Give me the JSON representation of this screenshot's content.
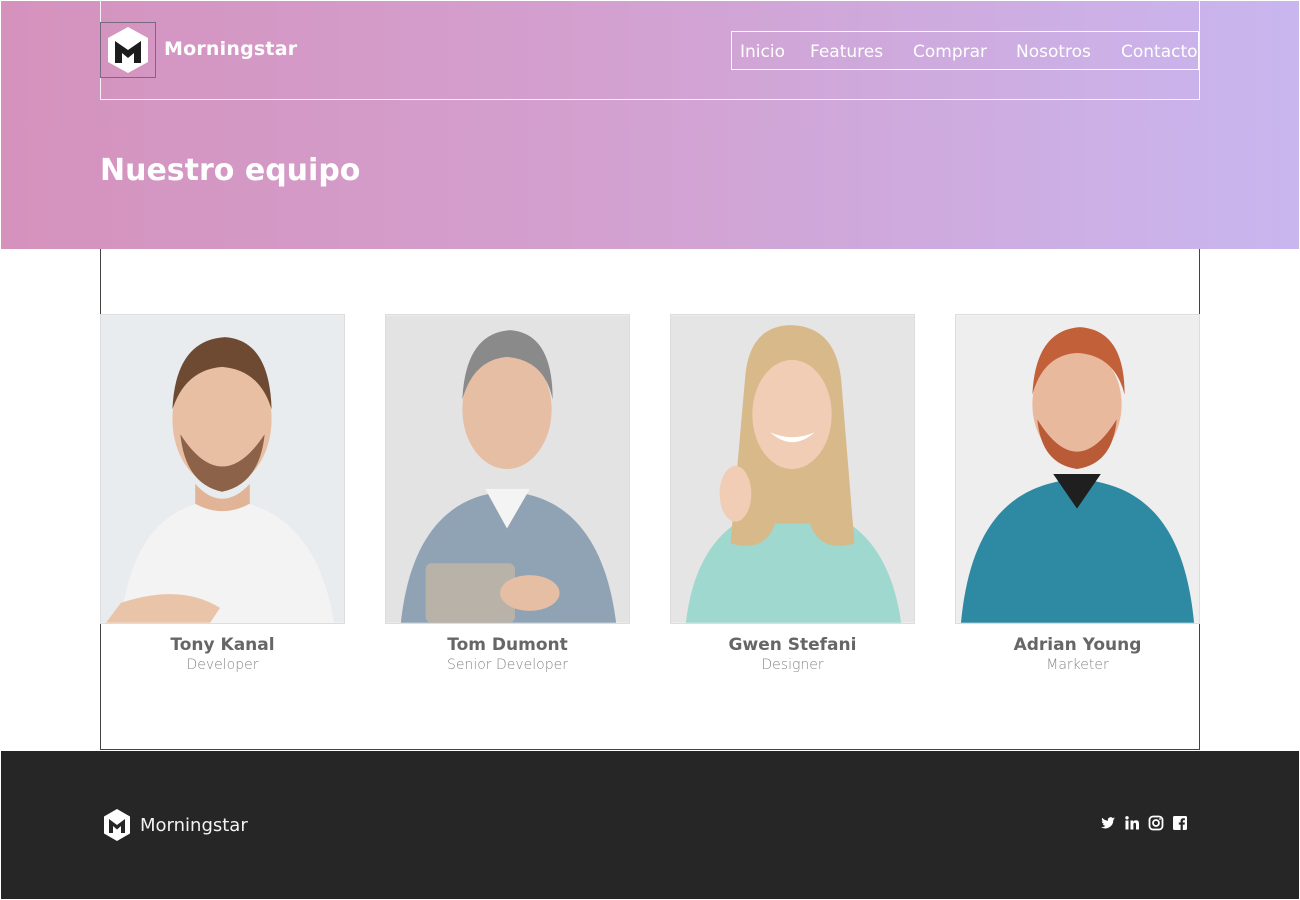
{
  "header": {
    "brand": "Morningstar",
    "logo_icon": "morningstar-hexagon-m-logo",
    "nav": [
      "Inicio",
      "Features",
      "Comprar",
      "Nosotros",
      "Contacto"
    ]
  },
  "hero": {
    "title": "Nuestro equipo",
    "gradient_start": "#d592bd",
    "gradient_end": "#c9b6ef"
  },
  "team": [
    {
      "name": "Tony Kanal",
      "role": "Developer"
    },
    {
      "name": "Tom Dumont",
      "role": "Senior Developer"
    },
    {
      "name": "Gwen Stefani",
      "role": "Designer"
    },
    {
      "name": "Adrian Young",
      "role": "Marketer"
    }
  ],
  "footer": {
    "brand": "Morningstar",
    "background": "#262626",
    "social_icons": [
      "twitter-icon",
      "linkedin-icon",
      "instagram-icon",
      "facebook-icon"
    ]
  }
}
